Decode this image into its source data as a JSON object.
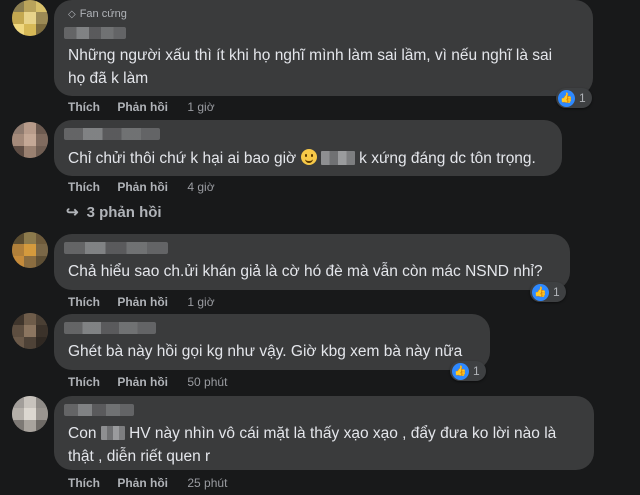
{
  "colors": {
    "background": "#18191a",
    "bubble": "#3a3b3c",
    "like_blue": "#2e89ff"
  },
  "comments": [
    {
      "badge": "Fan cứng",
      "lines": [
        "Những người xấu thì ít khi họ nghĩ mình làm sai lầm, vì nếu nghĩ là sai",
        "họ đã k làm"
      ],
      "like_label": "Thích",
      "reply_label": "Phản hồi",
      "time": "1 giờ",
      "reactions": "1"
    },
    {
      "text_before": "Chỉ chửi thôi chứ k hại ai bao giờ",
      "text_after": "k xứng đáng dc tôn trọng.",
      "like_label": "Thích",
      "reply_label": "Phản hồi",
      "time": "4 giờ"
    },
    {
      "lines": [
        "Chả hiểu sao ch.ửi khán giả là cờ hó đè mà vẫn còn mác NSND nhỉ?"
      ],
      "like_label": "Thích",
      "reply_label": "Phản hồi",
      "time": "1 giờ",
      "reactions": "1"
    },
    {
      "lines": [
        "Ghét bà này hồi gọi kg như vậy. Giờ kbg xem bà này nữa"
      ],
      "like_label": "Thích",
      "reply_label": "Phản hồi",
      "time": "50 phút",
      "reactions": "1"
    },
    {
      "text_before": "Con",
      "text_after": "HV này nhìn vô cái mặt là thấy xạo xạo , đẩy đưa ko lời nào là",
      "line2": "thật , diễn riết quen r",
      "like_label": "Thích",
      "reply_label": "Phản hồi",
      "time": "25 phút"
    }
  ],
  "replies_link": "3 phản hồi"
}
